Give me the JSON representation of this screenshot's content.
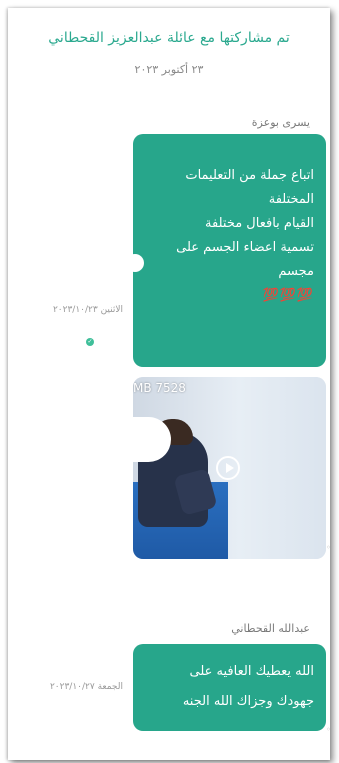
{
  "header": {
    "title": "تم مشاركتها مع عائلة عبدالعزيز القحطاني",
    "date": "٢٣ أكتوبر ٢٠٢٣"
  },
  "messages": [
    {
      "sender": "يسرى بوعزة",
      "lines": [
        "اتباع جملة من التعليمات",
        "المختلفة",
        "القيام بافعال مختلفة",
        "تسمية اعضاء الجسم على",
        "مجسم"
      ],
      "emojis": "💯💯💯",
      "time": "الاثنين ٢٠٢٣/١٠/٢٣",
      "read_icon": "check-icon"
    },
    {
      "media_size_label": "MB 7528",
      "play_icon": "play-icon"
    },
    {
      "sender": "عبدالله القحطاني",
      "lines": [
        "الله يعطيك العافيه على",
        "جهودك وجزاك الله الجنه"
      ],
      "time": "الجمعة ٢٠٢٣/١٠/٢٧"
    }
  ],
  "colors": {
    "accent": "#27a68b",
    "title": "#2ba98f",
    "muted": "#8a8a8a"
  }
}
